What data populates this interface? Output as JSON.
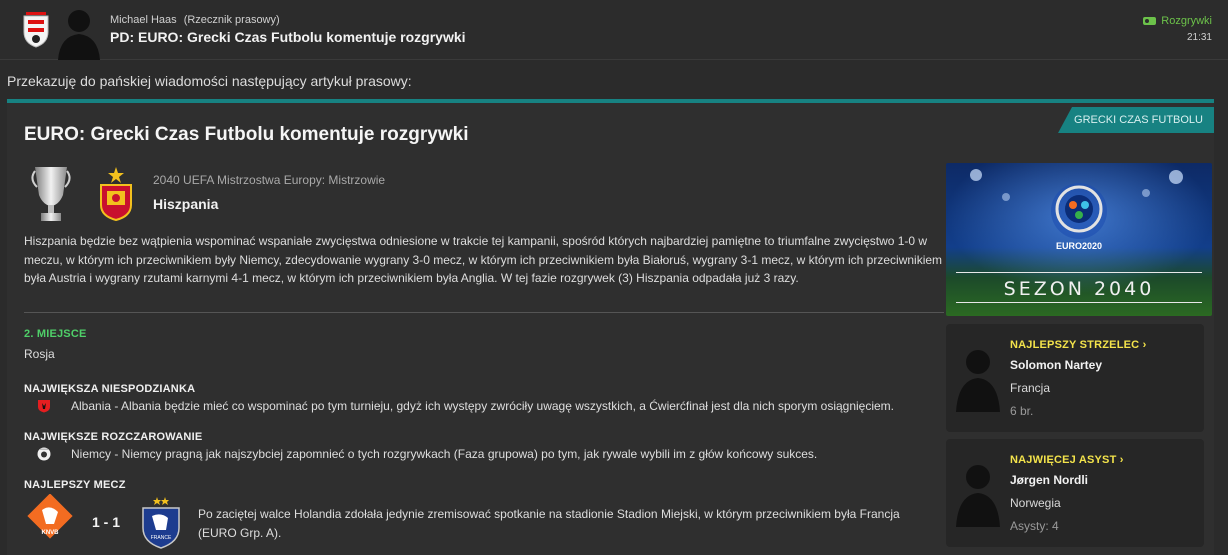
{
  "header": {
    "sender_name": "Michael Haas",
    "sender_role": "(Rzecznik prasowy)",
    "subject": "PD: EURO: Grecki Czas Futbolu komentuje rozgrywki",
    "tag_label": "Rozgrywki",
    "time": "21:31"
  },
  "intro": "Przekazuję do pańskiej wiadomości następujący artykuł prasowy:",
  "article": {
    "source_badge": "GRECKI CZAS FUTBOLU",
    "title": "EURO: Grecki Czas Futbolu komentuje rozgrywki",
    "competition": "2040 UEFA Mistrzostwa Europy: Mistrzowie",
    "winner": "Hiszpania",
    "paragraph": "Hiszpania będzie bez wątpienia wspominać wspaniałe zwycięstwa odniesione w trakcie tej kampanii, spośród których najbardziej pamiętne to triumfalne zwycięstwo 1-0 w meczu, w którym ich przeciwnikiem były Niemcy, zdecydowanie wygrany 3-0 mecz, w którym ich przeciwnikiem była Białoruś, wygrany 3-1 mecz, w którym ich przeciwnikiem była Austria i wygrany rzutami karnymi 4-1 mecz, w którym ich przeciwnikiem była Anglia. W tej fazie rozgrywek (3) Hiszpania odpadała już 3 razy.",
    "second_place_label": "2. MIEJSCE",
    "second_place_value": "Rosja",
    "surprise_label": "NAJWIĘKSZA NIESPODZIANKA",
    "surprise_text": "Albania - Albania będzie mieć co wspominać po tym turnieju, gdyż ich występy zwróciły uwagę wszystkich, a Ćwierćfinał jest dla nich sporym osiągnięciem.",
    "disappointment_label": "NAJWIĘKSZE ROZCZAROWANIE",
    "disappointment_text": "Niemcy - Niemcy pragną jak najszybciej zapomnieć o tych rozgrywkach (Faza grupowa) po tym, jak rywale wybili im z głów końcowy sukces.",
    "best_match_label": "NAJLEPSZY MECZ",
    "best_match_score": "1 - 1",
    "best_match_text": "Po zaciętej walce Holandia zdołała jedynie zremisować spotkanie na stadionie Stadion Miejski, w którym przeciwnikiem była Francja (EURO Grp. A).",
    "logo_text_netherlands": "KNVB",
    "logo_text_france": "FRANCE"
  },
  "banner": {
    "logo_text": "EURO2020",
    "season": "SEZON 2040"
  },
  "top_scorer": {
    "label": "NAJLEPSZY STRZELEC",
    "name": "Solomon Nartey",
    "nation": "Francja",
    "value": "6 br."
  },
  "top_assists": {
    "label": "NAJWIĘCEJ ASYST",
    "name": "Jørgen Nordli",
    "nation": "Norwegia",
    "value": "Asysty: 4"
  },
  "colors": {
    "accent": "#178282",
    "highlight_green": "#4fd069",
    "highlight_yellow": "#f3e34b",
    "tag_green": "#6cc24a"
  },
  "icons": [
    "austria-crest-icon",
    "trophy-icon",
    "spain-crest-icon",
    "albania-flag-icon",
    "germany-flag-icon",
    "netherlands-crest-icon",
    "france-crest-icon",
    "chevron-right-icon",
    "player-silhouette-icon"
  ]
}
